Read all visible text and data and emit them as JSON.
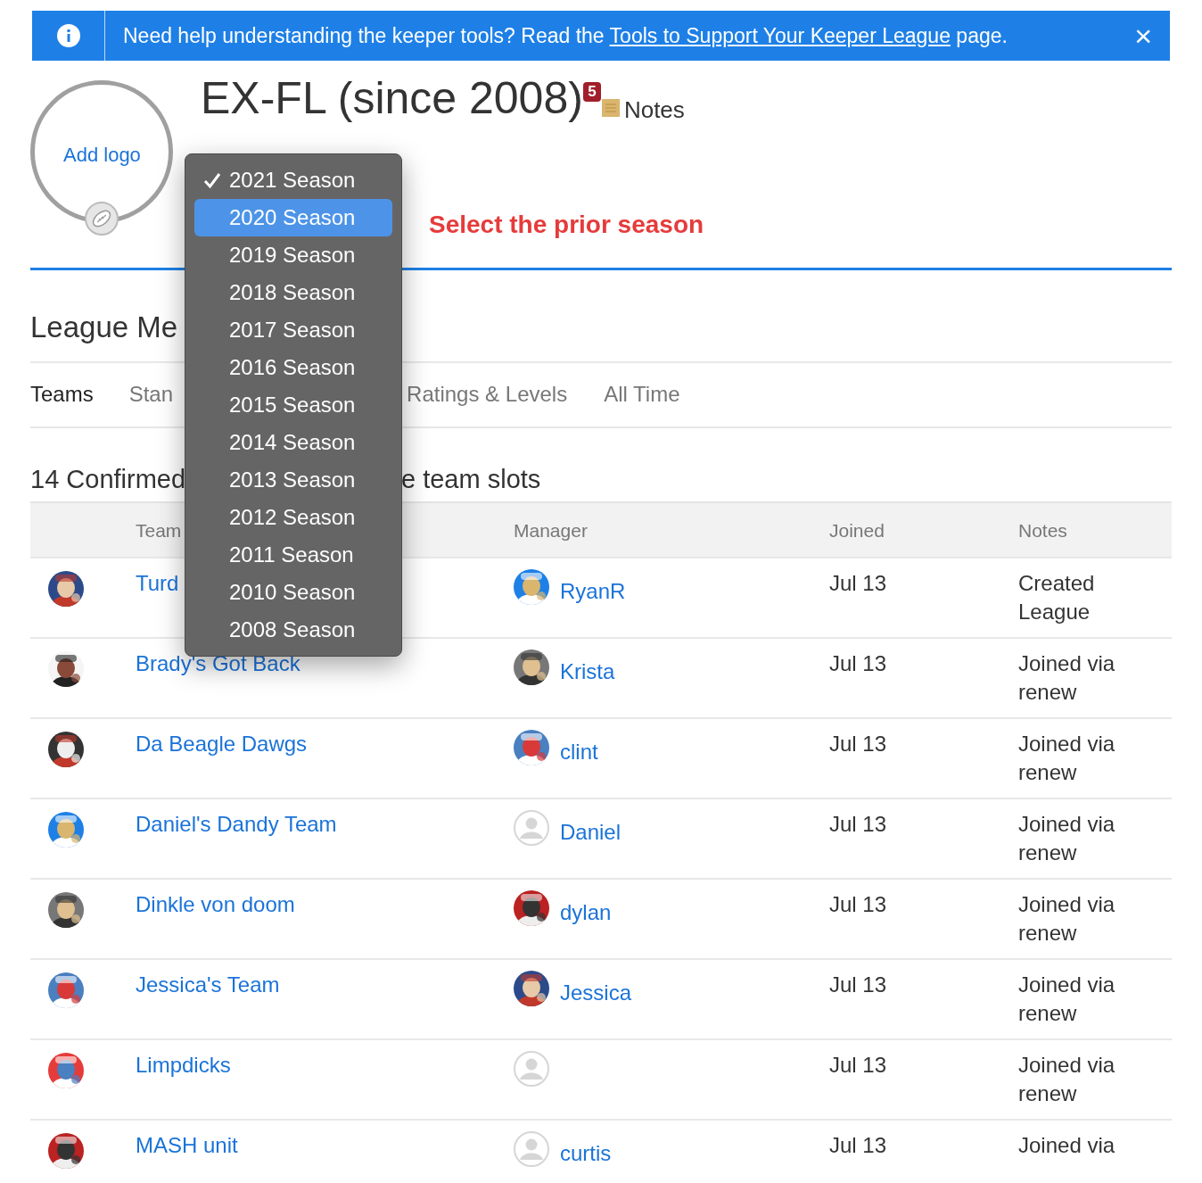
{
  "banner": {
    "text_before": "Need help understanding the keeper tools? Read the",
    "link": "Tools to Support Your Keeper League",
    "text_after": "page.",
    "close": "×"
  },
  "logo": {
    "label": "Add logo"
  },
  "title": "EX-FL (since 2008)",
  "notes_badge": "5",
  "notes_label": "Notes",
  "season_menu": [
    {
      "label": "2021 Season",
      "checked": true,
      "highlighted": false
    },
    {
      "label": "2020 Season",
      "checked": false,
      "highlighted": true
    },
    {
      "label": "2019 Season",
      "checked": false,
      "highlighted": false
    },
    {
      "label": "2018 Season",
      "checked": false,
      "highlighted": false
    },
    {
      "label": "2017 Season",
      "checked": false,
      "highlighted": false
    },
    {
      "label": "2016 Season",
      "checked": false,
      "highlighted": false
    },
    {
      "label": "2015 Season",
      "checked": false,
      "highlighted": false
    },
    {
      "label": "2014 Season",
      "checked": false,
      "highlighted": false
    },
    {
      "label": "2013 Season",
      "checked": false,
      "highlighted": false
    },
    {
      "label": "2012 Season",
      "checked": false,
      "highlighted": false
    },
    {
      "label": "2011 Season",
      "checked": false,
      "highlighted": false
    },
    {
      "label": "2010 Season",
      "checked": false,
      "highlighted": false
    },
    {
      "label": "2008 Season",
      "checked": false,
      "highlighted": false
    }
  ],
  "annotation": "Select the prior season",
  "section_title": "League Me",
  "tabs": [
    {
      "label": "Teams",
      "selected": true
    },
    {
      "label": "Stan",
      "selected": false
    },
    {
      "label": "Ratings & Levels",
      "selected": false
    },
    {
      "label": "All Time",
      "selected": false
    }
  ],
  "summary": {
    "left": "14 Confirmed",
    "right": "e team slots"
  },
  "table": {
    "columns": [
      "Team",
      "Manager",
      "Joined",
      "Notes"
    ],
    "rows": [
      {
        "team": "Turd",
        "manager": "RyanR",
        "manager_photo": true,
        "joined": "Jul 13",
        "notes": "Created League"
      },
      {
        "team": "Brady's Got Back",
        "manager": "Krista",
        "manager_photo": true,
        "joined": "Jul 13",
        "notes": "Joined via renew"
      },
      {
        "team": "Da Beagle Dawgs",
        "manager": "clint",
        "manager_photo": true,
        "joined": "Jul 13",
        "notes": "Joined via renew"
      },
      {
        "team": "Daniel's Dandy Team",
        "manager": "Daniel",
        "manager_photo": false,
        "joined": "Jul 13",
        "notes": "Joined via renew"
      },
      {
        "team": "Dinkle von doom",
        "manager": "dylan",
        "manager_photo": true,
        "joined": "Jul 13",
        "notes": "Joined via renew"
      },
      {
        "team": "Jessica's Team",
        "manager": "Jessica",
        "manager_photo": true,
        "joined": "Jul 13",
        "notes": "Joined via renew"
      },
      {
        "team": "Limpdicks",
        "manager_photo": false,
        "joined": "Jul 13",
        "notes": "Joined via renew"
      },
      {
        "team": "MASH unit",
        "manager": "curtis",
        "manager_photo": false,
        "joined": "Jul 13",
        "notes": "Joined via"
      }
    ]
  }
}
